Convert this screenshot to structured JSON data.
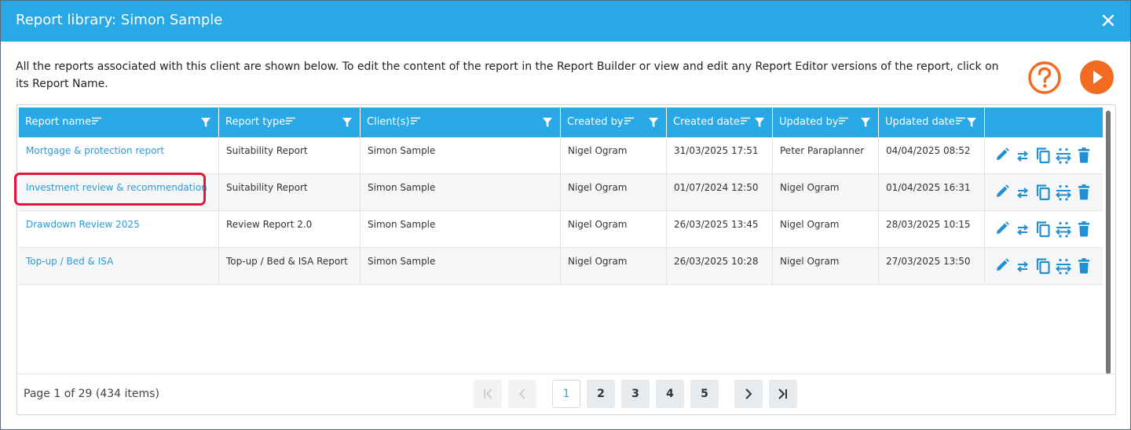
{
  "dialog": {
    "title": "Report library: Simon Sample",
    "intro": "All the reports associated with this client are shown below. To edit the content of the report in the Report Builder or view and edit any Report Editor versions of the report, click on its Report Name.",
    "close_icon": "close-icon",
    "help_icon": "question-circle-icon",
    "play_icon": "play-icon",
    "accent_color": "#29a8e6",
    "orange_color": "#f26b21",
    "highlight_color": "#e5143a"
  },
  "table": {
    "columns": [
      {
        "label": "Report name"
      },
      {
        "label": "Report type"
      },
      {
        "label": "Client(s)"
      },
      {
        "label": "Created by"
      },
      {
        "label": "Created date"
      },
      {
        "label": "Updated by"
      },
      {
        "label": "Updated date"
      },
      {
        "label": ""
      }
    ],
    "rows": [
      {
        "name": "Mortgage & protection report",
        "type": "Suitability Report",
        "client": "Simon Sample",
        "created_by": "Nigel Ogram",
        "created_date": "31/03/2025 17:51",
        "updated_by": "Peter Paraplanner",
        "updated_date": "04/04/2025 08:52"
      },
      {
        "name": "Investment review & recommendation",
        "type": "Suitability Report",
        "client": "Simon Sample",
        "created_by": "Nigel Ogram",
        "created_date": "01/07/2024 12:50",
        "updated_by": "Nigel Ogram",
        "updated_date": "01/04/2025 16:31"
      },
      {
        "name": "Drawdown Review 2025",
        "type": "Review Report 2.0",
        "client": "Simon Sample",
        "created_by": "Nigel Ogram",
        "created_date": "26/03/2025 13:45",
        "updated_by": "Nigel Ogram",
        "updated_date": "28/03/2025 10:15"
      },
      {
        "name": "Top-up / Bed & ISA",
        "type": "Top-up / Bed & ISA Report",
        "client": "Simon Sample",
        "created_by": "Nigel Ogram",
        "created_date": "26/03/2025 10:28",
        "updated_by": "Nigel Ogram",
        "updated_date": "27/03/2025 13:50"
      }
    ],
    "row_actions": [
      "pencil-icon",
      "swap-arrows-icon",
      "copy-icon",
      "merge-icon",
      "trash-icon"
    ],
    "highlighted_row": 1
  },
  "pagination": {
    "info": "Page 1 of 29 (434 items)",
    "pages": [
      "1",
      "2",
      "3",
      "4",
      "5"
    ],
    "current_page": "1"
  }
}
